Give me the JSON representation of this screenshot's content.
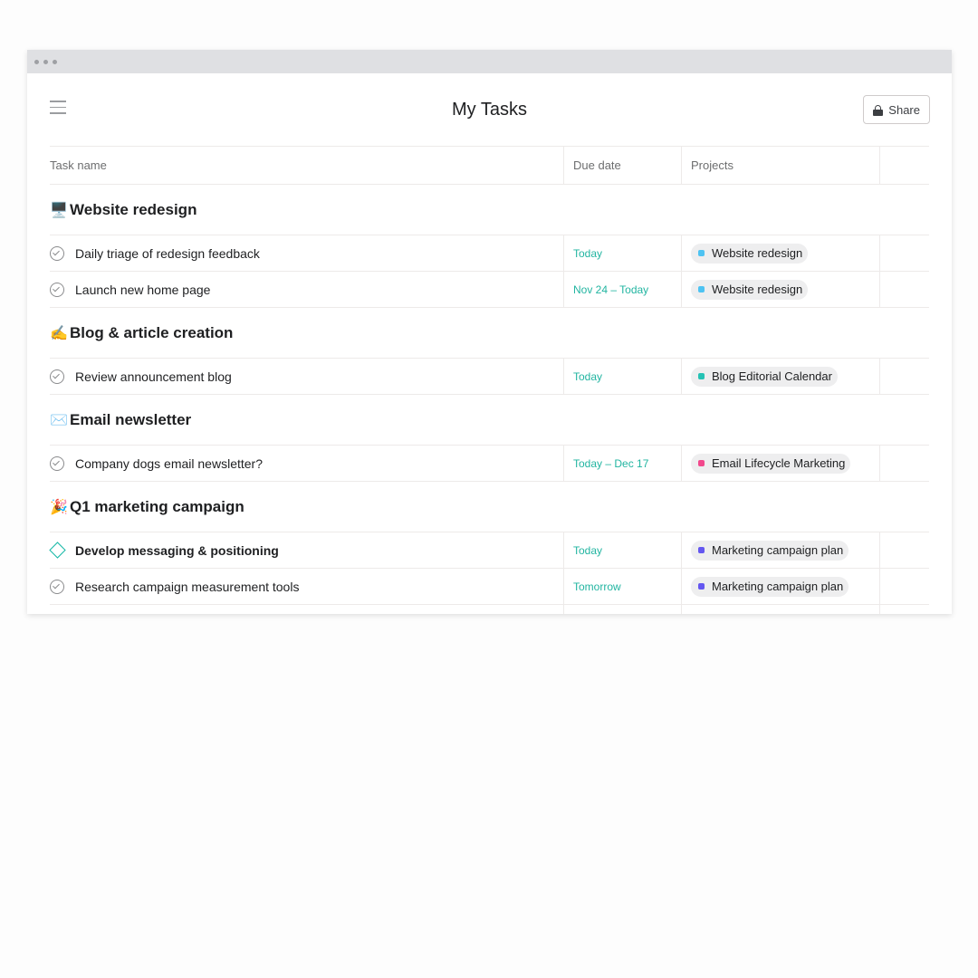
{
  "window": {
    "title": "My Tasks"
  },
  "header": {
    "share_label": "Share"
  },
  "columns": {
    "task": "Task name",
    "due": "Due date",
    "projects": "Projects"
  },
  "colors": {
    "due_text": "#22b5a1",
    "accent": "#14b8a6"
  },
  "sections": [
    {
      "emoji": "🖥️",
      "title": "Website redesign",
      "tasks": [
        {
          "name": "Daily triage of redesign feedback",
          "due": "Today",
          "project": "Website redesign",
          "project_color": "#4ec3f2",
          "status": "check"
        },
        {
          "name": "Launch new home page",
          "due": "Nov 24 – Today",
          "project": "Website redesign",
          "project_color": "#4ec3f2",
          "status": "check"
        }
      ]
    },
    {
      "emoji": "✍️",
      "title": "Blog & article creation",
      "tasks": [
        {
          "name": "Review announcement blog",
          "due": "Today",
          "project": "Blog Editorial Calendar",
          "project_color": "#25c2b4",
          "status": "check"
        }
      ]
    },
    {
      "emoji": "✉️",
      "title": "Email newsletter",
      "tasks": [
        {
          "name": "Company dogs email newsletter?",
          "due": "Today – Dec 17",
          "project": "Email Lifecycle Marketing",
          "project_color": "#f2488c",
          "status": "check"
        }
      ]
    },
    {
      "emoji": "🎉",
      "title": "Q1 marketing campaign",
      "tasks": [
        {
          "name": "Develop messaging & positioning",
          "due": "Today",
          "project": "Marketing campaign plan",
          "project_color": "#6457f0",
          "status": "milestone"
        },
        {
          "name": "Research campaign measurement tools",
          "due": "Tomorrow",
          "project": "Marketing campaign plan",
          "project_color": "#6457f0",
          "status": "check"
        }
      ]
    }
  ]
}
